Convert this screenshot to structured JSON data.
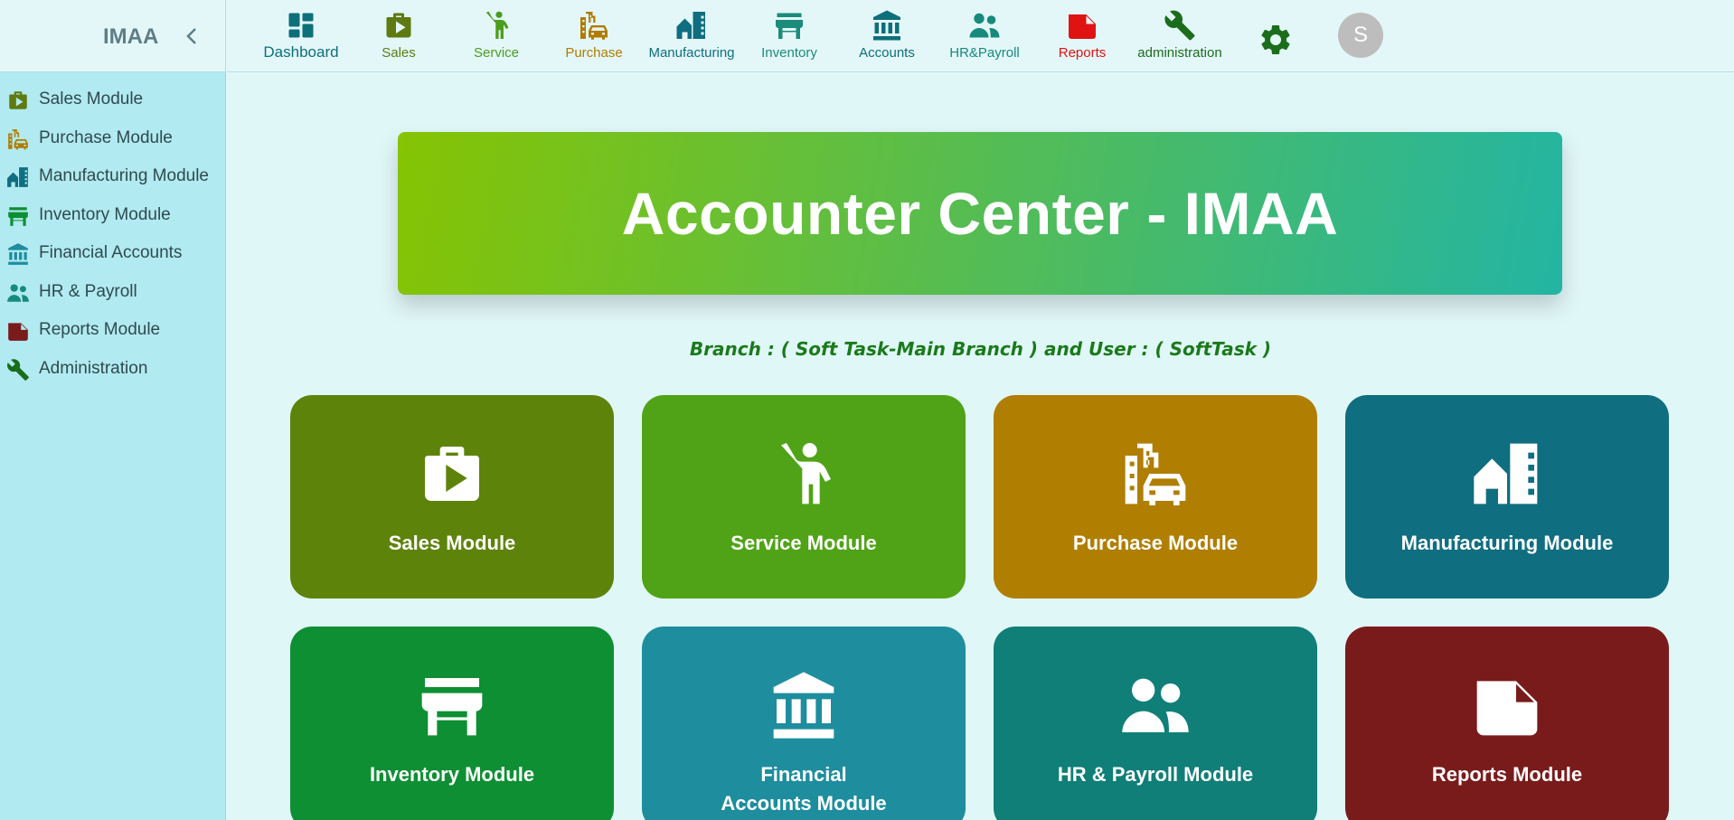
{
  "app": {
    "brand": "IMAA"
  },
  "topnav": {
    "items": [
      {
        "label": "Dashboard",
        "color": "#0d6f7a",
        "icon": "dashboard-icon"
      },
      {
        "label": "Sales",
        "color": "#5e7a10",
        "icon": "shopping-bag-icon"
      },
      {
        "label": "Service",
        "color": "#4b9d1c",
        "icon": "person-waving-icon"
      },
      {
        "label": "Purchase",
        "color": "#b17c00",
        "icon": "building-car-icon"
      },
      {
        "label": "Manufacturing",
        "color": "#0f6e7f",
        "icon": "factory-icon"
      },
      {
        "label": "Inventory",
        "color": "#1b8b7a",
        "icon": "store-icon"
      },
      {
        "label": "Accounts",
        "color": "#0d6f7a",
        "icon": "bank-icon"
      },
      {
        "label": "HR&Payroll",
        "color": "#178a7c",
        "icon": "people-icon"
      },
      {
        "label": "Reports",
        "color": "#e01313",
        "icon": "report-icon"
      },
      {
        "label": "administration",
        "color": "#1b6d1b",
        "icon": "wrench-icon"
      }
    ],
    "settings_icon": "gear-icon",
    "avatar_initial": "S"
  },
  "sidebar": {
    "items": [
      {
        "label": "Sales Module",
        "color": "#5e7a10",
        "icon": "shopping-bag-icon"
      },
      {
        "label": "Purchase Module",
        "color": "#b17c00",
        "icon": "building-car-icon"
      },
      {
        "label": "Manufacturing Module",
        "color": "#0f6e7f",
        "icon": "factory-icon"
      },
      {
        "label": "Inventory Module",
        "color": "#0e8f33",
        "icon": "store-icon"
      },
      {
        "label": "Financial Accounts",
        "color": "#1e8d9e",
        "icon": "bank-icon"
      },
      {
        "label": "HR & Payroll",
        "color": "#178a7c",
        "icon": "people-icon"
      },
      {
        "label": "Reports Module",
        "color": "#7a1b1b",
        "icon": "report-icon"
      },
      {
        "label": "Administration",
        "color": "#1b6d1b",
        "icon": "wrench-icon"
      }
    ]
  },
  "main": {
    "banner_title": "Accounter Center - IMAA",
    "branch_line": "Branch : ( Soft Task-Main Branch ) and User : ( SoftTask )",
    "cards": [
      {
        "label": "Sales Module",
        "color": "#5e830a",
        "icon": "shopping-bag-icon"
      },
      {
        "label": "Service Module",
        "color": "#50a316",
        "icon": "person-waving-icon"
      },
      {
        "label": "Purchase Module",
        "color": "#b07e00",
        "icon": "building-car-icon"
      },
      {
        "label": "Manufacturing Module",
        "color": "#0f6e7f",
        "icon": "factory-icon"
      },
      {
        "label": "Inventory Module",
        "color": "#0e8f33",
        "icon": "store-icon"
      },
      {
        "label": "Financial Accounts Module",
        "color": "#1e8d9e",
        "icon": "bank-icon"
      },
      {
        "label": "HR & Payroll Module",
        "color": "#0f7f78",
        "icon": "people-icon"
      },
      {
        "label": "Reports Module",
        "color": "#7a1b1b",
        "icon": "report-icon"
      }
    ]
  }
}
